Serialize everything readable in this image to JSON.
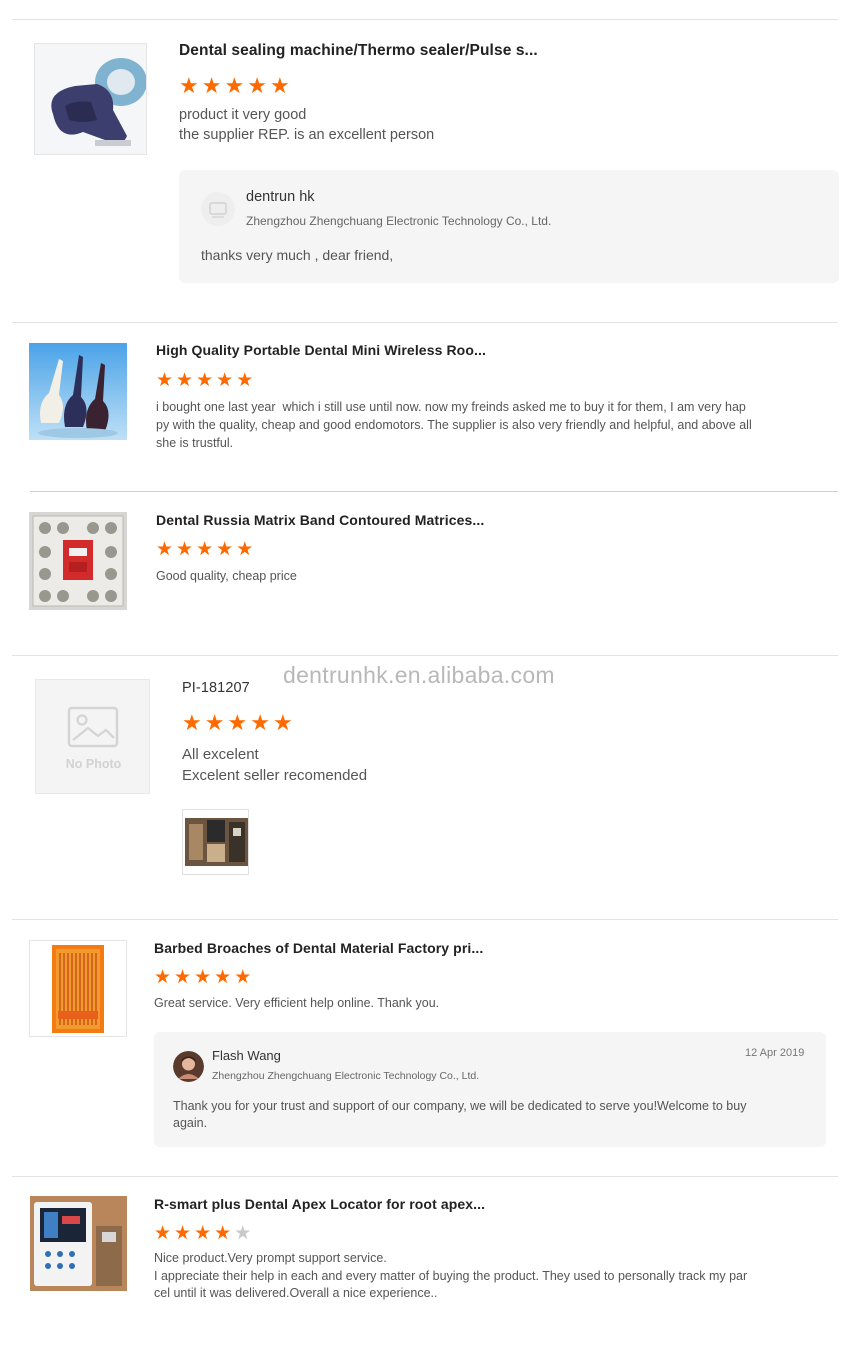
{
  "watermark": "dentrunhk.en.alibaba.com",
  "reviews": [
    {
      "title": "Dental sealing machine/Thermo sealer/Pulse s...",
      "stars": 5,
      "image_icon": "sealing-machine-photo",
      "lines": [
        "product it very good",
        "the supplier REP. is an excellent person"
      ],
      "reply": {
        "name": "dentrun hk",
        "company": "Zhengzhou Zhengchuang Electronic Technology Co., Ltd.",
        "text": "thanks very much , dear friend,",
        "avatar_icon": "company-logo-avatar"
      }
    },
    {
      "title": "High Quality Portable Dental Mini Wireless Roo...",
      "stars": 5,
      "image_icon": "endomotor-photo",
      "lines": [
        "i bought one last year  which i still use until now. now my freinds asked me to buy it for them, I am very hap",
        "py with the quality, cheap and good endomotors. The supplier is also very friendly and helpful, and above all",
        "she is trustful."
      ]
    },
    {
      "title": "Dental Russia Matrix Band Contoured Matrices...",
      "stars": 5,
      "image_icon": "matrix-band-kit-photo",
      "lines": [
        "Good quality, cheap price"
      ]
    },
    {
      "reviewer": "PI-181207",
      "stars": 5,
      "image_icon": "no-photo-placeholder",
      "placeholder_text": "No Photo",
      "lines": [
        "All excelent",
        "Excelent seller recomended"
      ],
      "attachment_icon": "customer-photo-attachment"
    },
    {
      "title": "Barbed Broaches of Dental Material Factory pri...",
      "stars": 5,
      "image_icon": "barbed-broaches-photo",
      "lines": [
        "Great service. Very efficient help online. Thank you."
      ],
      "reply": {
        "name": "Flash Wang",
        "company": "Zhengzhou Zhengchuang Electronic Technology Co., Ltd.",
        "date": "12 Apr 2019",
        "text_lines": [
          "Thank you for your trust and support of our company, we will be dedicated to serve you!Welcome to buy",
          "again."
        ],
        "avatar_icon": "user-avatar"
      }
    },
    {
      "title": "R-smart plus Dental Apex Locator for root apex...",
      "stars": 4,
      "image_icon": "apex-locator-photo",
      "lines": [
        "Nice product.Very prompt support service.",
        "I appreciate their help in each and every matter of buying the product. They used to personally track my par",
        "cel until it was delivered.Overall a nice experience.."
      ]
    }
  ],
  "colors": {
    "star": "#ff6a00",
    "star_off": "#c9c9c9",
    "reply_bg": "#f5f5f5"
  }
}
